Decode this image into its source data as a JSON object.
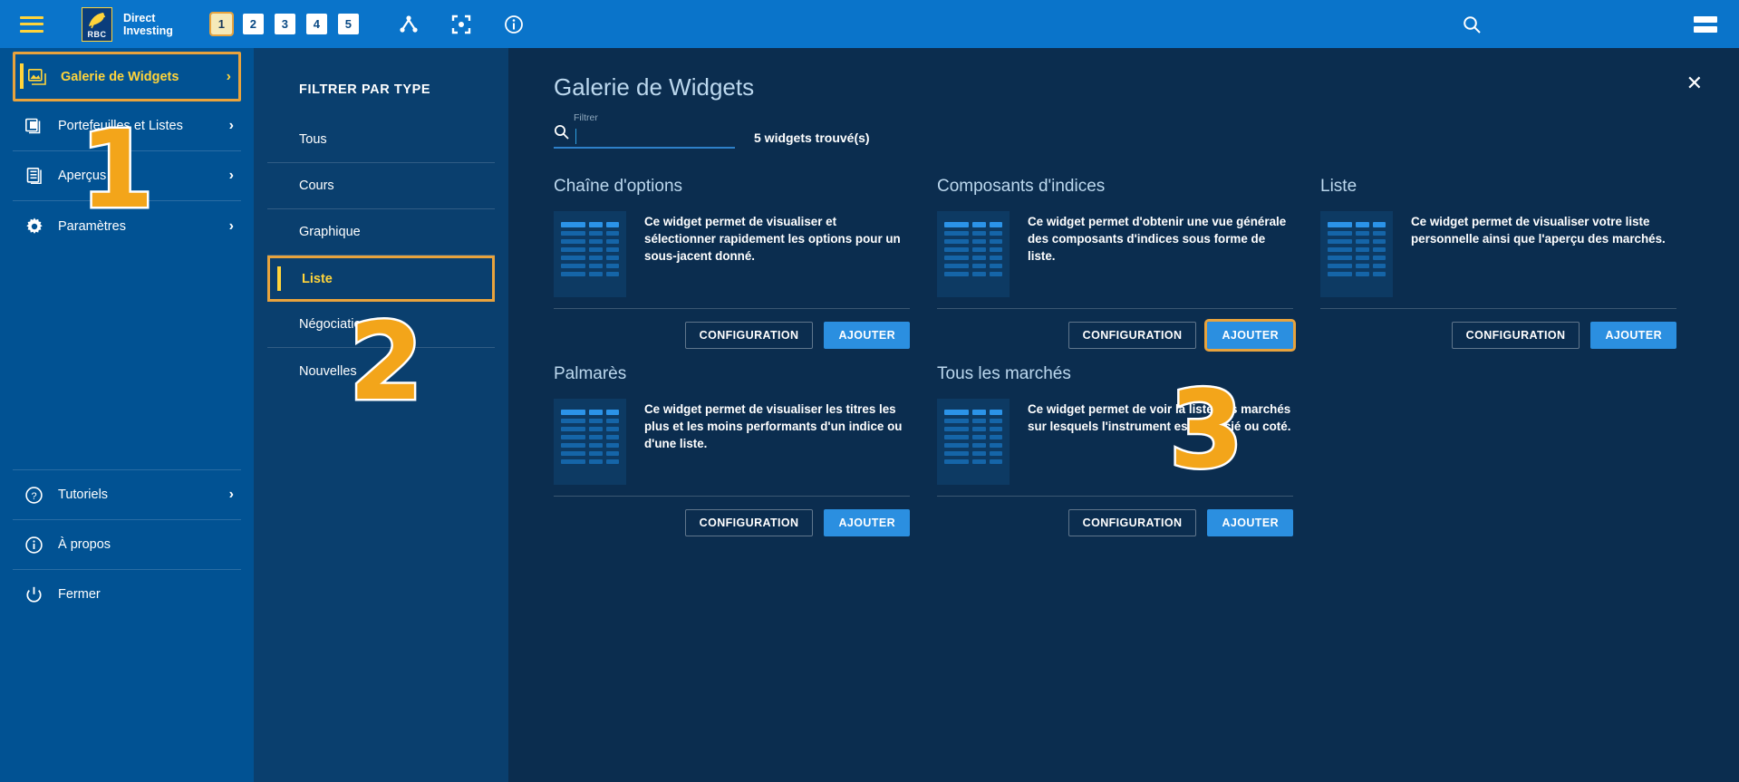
{
  "topbar": {
    "menu_icon": "hamburger-icon",
    "logo_text": "RBC",
    "brand_line1": "Direct",
    "brand_line2": "Investing",
    "tabs": [
      {
        "label": "1",
        "active": true
      },
      {
        "label": "2",
        "active": false
      },
      {
        "label": "3",
        "active": false
      },
      {
        "label": "4",
        "active": false
      },
      {
        "label": "5",
        "active": false
      }
    ],
    "icons": [
      "share-node-icon",
      "focus-target-icon",
      "info-circle-icon"
    ],
    "search_icon": "search-icon",
    "right_menu_icon": "list-menu-icon"
  },
  "sidebar": {
    "items": [
      {
        "label": "Galerie de Widgets",
        "icon": "image-gallery-icon",
        "chevron": true,
        "active": true
      },
      {
        "label": "Portefeuilles et Listes",
        "icon": "portfolio-icon",
        "chevron": true,
        "active": false
      },
      {
        "label": "Aperçus",
        "icon": "overview-icon",
        "chevron": true,
        "active": false
      },
      {
        "label": "Paramètres",
        "icon": "gear-icon",
        "chevron": true,
        "active": false
      }
    ],
    "bottom_items": [
      {
        "label": "Tutoriels",
        "icon": "question-circle-icon",
        "chevron": true
      },
      {
        "label": "À propos",
        "icon": "info-circle-icon",
        "chevron": false
      },
      {
        "label": "Fermer",
        "icon": "power-icon",
        "chevron": false
      }
    ]
  },
  "filterpanel": {
    "title": "FILTRER PAR TYPE",
    "items": [
      {
        "label": "Tous",
        "active": false
      },
      {
        "label": "Cours",
        "active": false
      },
      {
        "label": "Graphique",
        "active": false
      },
      {
        "label": "Liste",
        "active": true
      },
      {
        "label": "Négociation",
        "active": false
      },
      {
        "label": "Nouvelles",
        "active": false
      }
    ]
  },
  "main": {
    "title": "Galerie de Widgets",
    "close_icon": "close-icon",
    "search": {
      "label": "Filtrer",
      "value": "",
      "placeholder": "",
      "icon": "search-icon"
    },
    "result_count": "5 widgets trouvé(s)",
    "button_config_label": "CONFIGURATION",
    "button_add_label": "AJOUTER",
    "cards": [
      {
        "title": "Chaîne d'options",
        "description": "Ce widget permet de visualiser et sélectionner rapidement les options pour un sous-jacent donné.",
        "add_highlighted": false
      },
      {
        "title": "Composants d'indices",
        "description": "Ce widget permet d'obtenir une vue générale des composants d'indices sous forme de liste.",
        "add_highlighted": true
      },
      {
        "title": "Liste",
        "description": "Ce widget permet de visualiser votre liste personnelle ainsi que l'aperçu des marchés.",
        "add_highlighted": false
      },
      {
        "title": "Palmarès",
        "description": "Ce widget permet de visualiser les titres les plus et les moins performants d'un indice ou d'une liste.",
        "add_highlighted": false
      },
      {
        "title": "Tous les marchés",
        "description": "Ce widget permet de voir la liste des marchés sur lesquels l'instrument est négocié ou coté.",
        "add_highlighted": false
      }
    ]
  },
  "annotations": [
    {
      "label": "1"
    },
    {
      "label": "2"
    },
    {
      "label": "3"
    }
  ],
  "colors": {
    "topbar_blue": "#0a74ca",
    "sidebar_blue": "#015293",
    "filter_blue": "#0a3f6e",
    "main_blue": "#0b2d4f",
    "accent_gold": "#e8a33d",
    "highlight_yellow": "#ffd43b",
    "button_blue": "#2b8fe0",
    "annotation_orange": "#f3a51a"
  }
}
